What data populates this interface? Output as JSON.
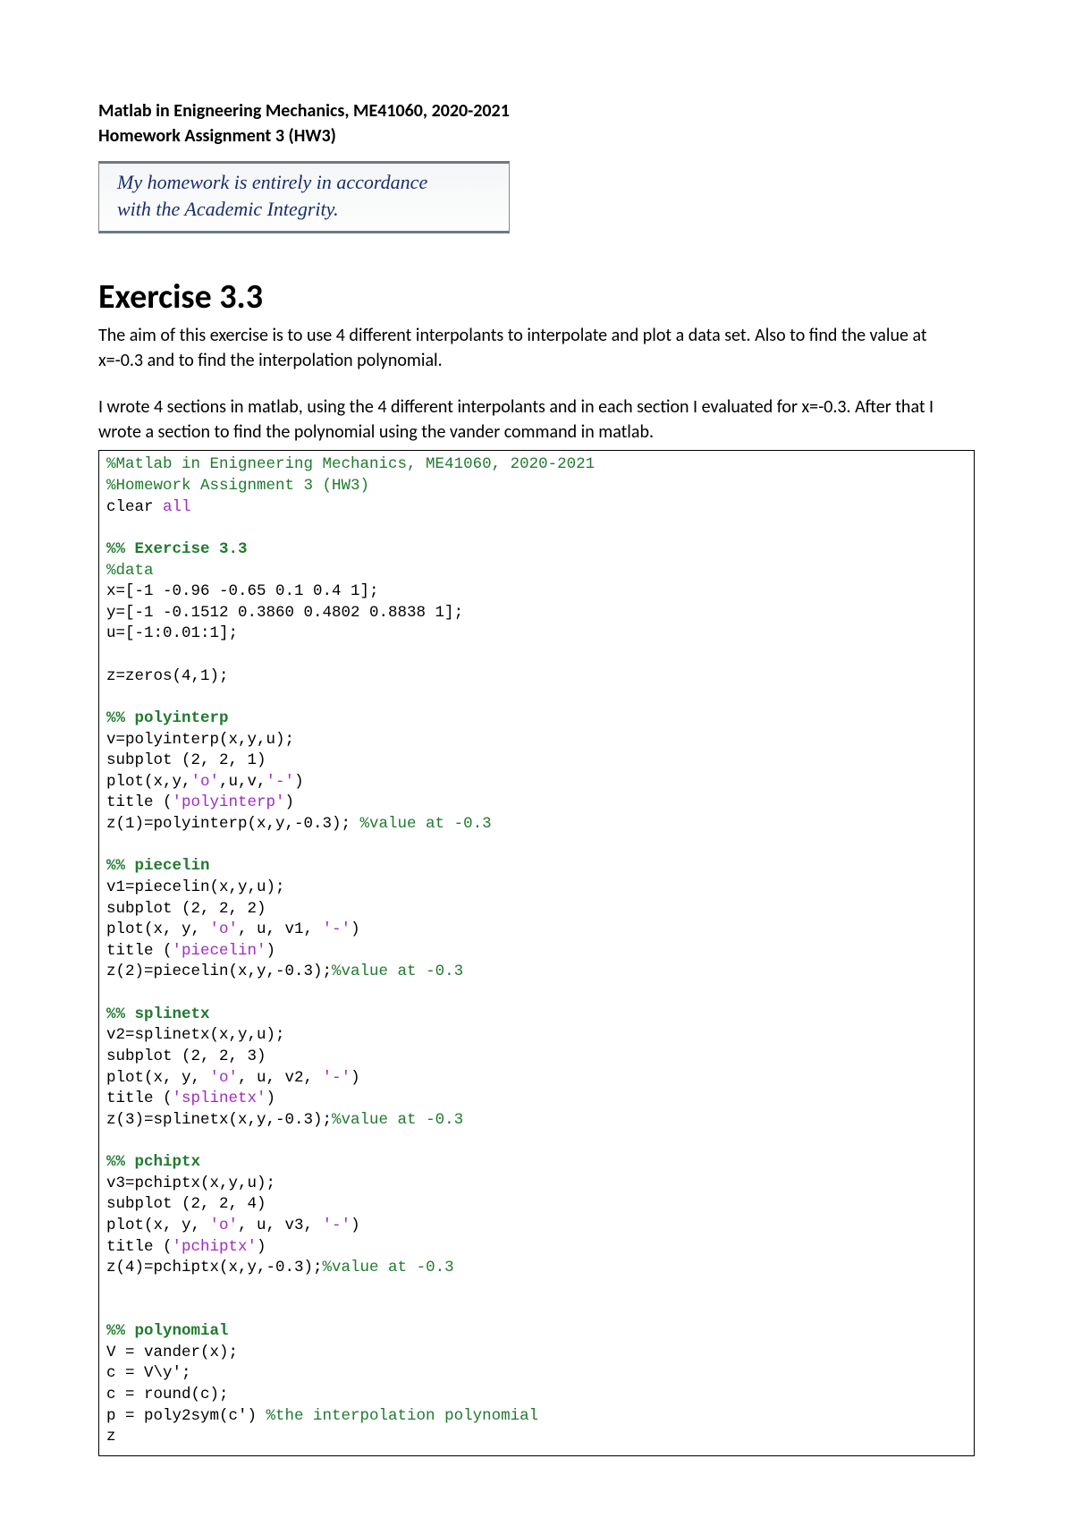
{
  "header": {
    "line1": "Matlab in Enigneering Mechanics, ME41060, 2020-2021",
    "line2": "Homework Assignment 3 (HW3)"
  },
  "handwritten": {
    "line1": "My homework is entirely in accordance",
    "line2": "with the Academic Integrity."
  },
  "exercise": {
    "title": "Exercise 3.3",
    "p1": "The aim of this exercise is to use 4 different interpolants to interpolate and plot a data set. Also to find the value at x=-0.3 and to find the interpolation polynomial.",
    "p2": "I wrote 4 sections in matlab, using the 4 different interpolants and in each section I evaluated for x=-0.3. After that I wrote a section to find the polynomial using the vander command in matlab."
  },
  "code": {
    "c01": "%Matlab in Enigneering Mechanics, ME41060, 2020-2021",
    "c02": "%Homework Assignment 3 (HW3)",
    "c03a": "clear ",
    "c03b": "all",
    "sec1": "%% Exercise 3.3",
    "c04": "%data",
    "c05": "x=[-1 -0.96 -0.65 0.1 0.4 1];",
    "c06": "y=[-1 -0.1512 0.3860 0.4802 0.8838 1];",
    "c07": "u=[-1:0.01:1];",
    "c08": "z=zeros(4,1);",
    "sec2": "%% polyinterp",
    "c09": "v=polyinterp(x,y,u);",
    "c10": "subplot (2, 2, 1)",
    "c11a": "plot(x,y,",
    "c11b": "'o'",
    "c11c": ",u,v,",
    "c11d": "'-'",
    "c11e": ")",
    "c12a": "title (",
    "c12b": "'polyinterp'",
    "c12c": ")",
    "c13a": "z(1)=polyinterp(x,y,-0.3); ",
    "c13b": "%value at -0.3",
    "sec3": "%% piecelin",
    "c14": "v1=piecelin(x,y,u);",
    "c15": "subplot (2, 2, 2)",
    "c16a": "plot(x, y, ",
    "c16b": "'o'",
    "c16c": ", u, v1, ",
    "c16d": "'-'",
    "c16e": ")",
    "c17a": "title (",
    "c17b": "'piecelin'",
    "c17c": ")",
    "c18a": "z(2)=piecelin(x,y,-0.3);",
    "c18b": "%value at -0.3",
    "sec4": "%% splinetx",
    "c19": "v2=splinetx(x,y,u);",
    "c20": "subplot (2, 2, 3)",
    "c21a": "plot(x, y, ",
    "c21b": "'o'",
    "c21c": ", u, v2, ",
    "c21d": "'-'",
    "c21e": ")",
    "c22a": "title (",
    "c22b": "'splinetx'",
    "c22c": ")",
    "c23a": "z(3)=splinetx(x,y,-0.3);",
    "c23b": "%value at -0.3",
    "sec5": "%% pchiptx",
    "c24": "v3=pchiptx(x,y,u);",
    "c25": "subplot (2, 2, 4)",
    "c26a": "plot(x, y, ",
    "c26b": "'o'",
    "c26c": ", u, v3, ",
    "c26d": "'-'",
    "c26e": ")",
    "c27a": "title (",
    "c27b": "'pchiptx'",
    "c27c": ")",
    "c28a": "z(4)=pchiptx(x,y,-0.3);",
    "c28b": "%value at -0.3",
    "sec6": "%% polynomial",
    "c29": "V = vander(x);",
    "c30": "c = V\\y';",
    "c31": "c = round(c);",
    "c32a": "p = poly2sym(c') ",
    "c32b": "%the interpolation polynomial",
    "c33": "z"
  }
}
